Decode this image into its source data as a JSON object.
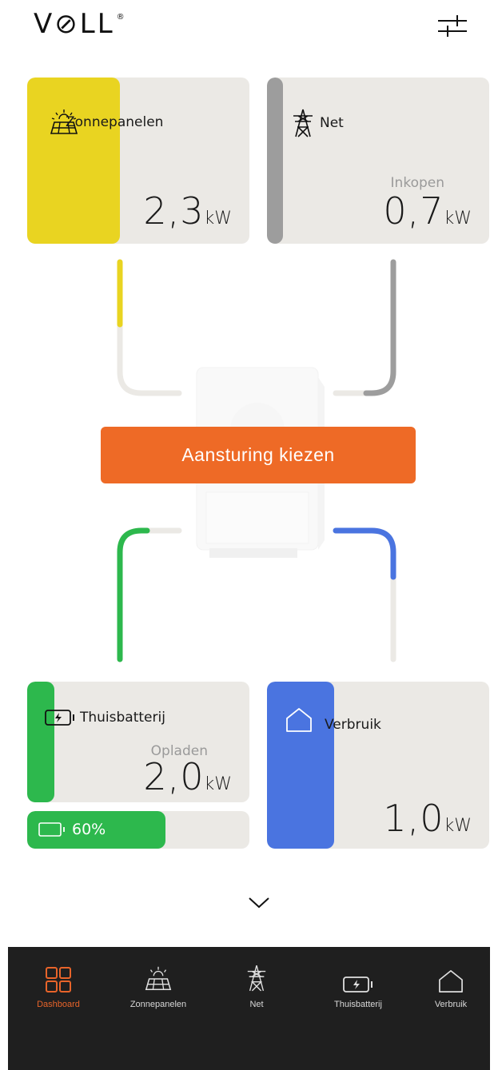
{
  "header": {
    "logo_text": "V⊘LL",
    "logo_mark": "®",
    "filter_icon": "sliders-icon"
  },
  "cards": {
    "solar": {
      "title": "Zonnepanelen",
      "value": "2,3",
      "unit": "kW",
      "color": "#e9d421",
      "level": 0.42
    },
    "grid": {
      "title": "Net",
      "sub": "Inkopen",
      "value": "0,7",
      "unit": "kW",
      "color": "#9d9d9d",
      "level": 0.07
    },
    "battery": {
      "title": "Thuisbatterij",
      "sub": "Opladen",
      "value": "2,0",
      "unit": "kW",
      "color": "#2db84d",
      "level": 0.12,
      "charge": "60%",
      "charge_level": 0.6
    },
    "usage": {
      "title": "Verbruik",
      "value": "1,0",
      "unit": "kW",
      "color": "#4a74e0",
      "level": 0.3
    }
  },
  "cta": {
    "label": "Aansturing kiezen",
    "color": "#ee6a26"
  },
  "expand_icon": "chevron-down-icon",
  "nav": {
    "active_color": "#e8642a",
    "items": [
      {
        "label": "Dashboard",
        "icon": "dashboard-grid-icon",
        "active": true
      },
      {
        "label": "Zonnepanelen",
        "icon": "solar-panel-icon",
        "active": false
      },
      {
        "label": "Net",
        "icon": "power-pylon-icon",
        "active": false
      },
      {
        "label": "Thuisbatterij",
        "icon": "battery-icon",
        "active": false
      },
      {
        "label": "Verbruik",
        "icon": "house-icon",
        "active": false
      }
    ]
  }
}
